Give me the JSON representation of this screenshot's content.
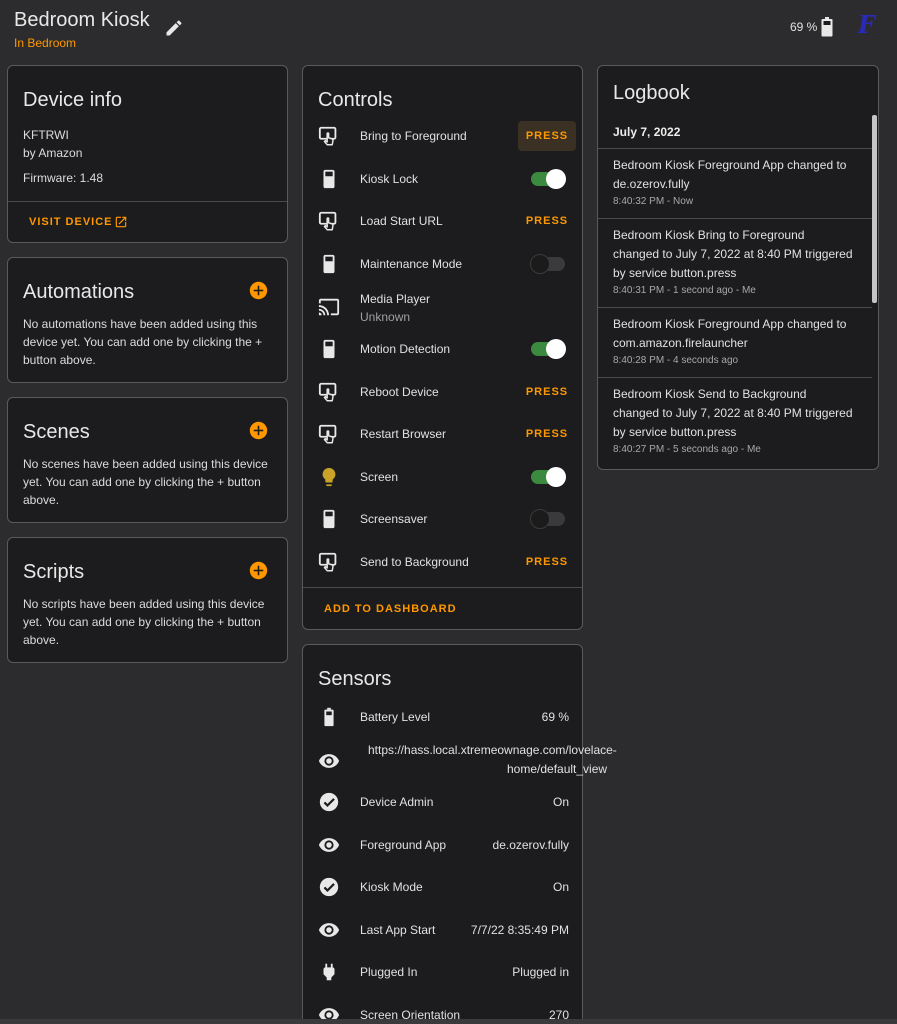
{
  "header": {
    "title": "Bedroom Kiosk",
    "subtitle": "In Bedroom",
    "battery": "69 %",
    "app_badge": "F"
  },
  "device_info": {
    "title": "Device info",
    "model": "KFTRWI",
    "manufacturer": "by Amazon",
    "firmware": "Firmware: 1.48",
    "visit_label": "VISIT DEVICE"
  },
  "automations": {
    "title": "Automations",
    "text": "No automations have been added using this device yet. You can add one by clicking the + button above."
  },
  "scenes": {
    "title": "Scenes",
    "text": "No scenes have been added using this device yet. You can add one by clicking the + button above."
  },
  "scripts": {
    "title": "Scripts",
    "text": "No scripts have been added using this device yet. You can add one by clicking the + button above."
  },
  "controls": {
    "title": "Controls",
    "press_label": "PRESS",
    "add_to_dashboard": "ADD TO DASHBOARD",
    "rows": [
      {
        "label": "Bring to Foreground",
        "icon": "gesture-tap-icon",
        "kind": "press"
      },
      {
        "label": "Kiosk Lock",
        "icon": "tablet-icon",
        "kind": "toggle",
        "on": true
      },
      {
        "label": "Load Start URL",
        "icon": "gesture-tap-icon",
        "kind": "press"
      },
      {
        "label": "Maintenance Mode",
        "icon": "tablet-icon",
        "kind": "toggle",
        "on": false
      },
      {
        "label": "Media Player",
        "sub": "Unknown",
        "icon": "cast-icon",
        "kind": "state"
      },
      {
        "label": "Motion Detection",
        "icon": "tablet-icon",
        "kind": "toggle",
        "on": true
      },
      {
        "label": "Reboot Device",
        "icon": "gesture-tap-icon",
        "kind": "press"
      },
      {
        "label": "Restart Browser",
        "icon": "gesture-tap-icon",
        "kind": "press"
      },
      {
        "label": "Screen",
        "icon": "lightbulb-icon",
        "kind": "toggle",
        "on": true
      },
      {
        "label": "Screensaver",
        "icon": "tablet-icon",
        "kind": "toggle",
        "on": false
      },
      {
        "label": "Send to Background",
        "icon": "gesture-tap-icon",
        "kind": "press"
      }
    ]
  },
  "sensors": {
    "title": "Sensors",
    "rows": [
      {
        "label": "Battery Level",
        "value": "69 %",
        "icon": "battery-icon"
      },
      {
        "label": "",
        "value": "https://hass.local.xtremeownage.com/lovelace-home/default_view",
        "value_line1": "https://hass.local.xtremeownage.com/lovelace-",
        "value_line2": "home/default_view",
        "icon": "eye-icon"
      },
      {
        "label": "Device Admin",
        "value": "On",
        "icon": "check-circle-icon"
      },
      {
        "label": "Foreground App",
        "value": "de.ozerov.fully",
        "icon": "eye-icon"
      },
      {
        "label": "Kiosk Mode",
        "value": "On",
        "icon": "check-circle-icon"
      },
      {
        "label": "Last App Start",
        "value": "7/7/22 8:35:49 PM",
        "icon": "eye-icon"
      },
      {
        "label": "Plugged In",
        "value": "Plugged in",
        "icon": "power-plug-icon"
      },
      {
        "label": "Screen Orientation",
        "value": "270",
        "icon": "eye-icon"
      }
    ]
  },
  "logbook": {
    "title": "Logbook",
    "date": "July 7, 2022",
    "entries": [
      {
        "line1": "Bedroom Kiosk Foreground App changed to",
        "line2": "de.ozerov.fully",
        "line3": "",
        "meta": "8:40:32 PM - Now"
      },
      {
        "line1": "Bedroom Kiosk Bring to Foreground",
        "line2": "changed to July 7, 2022 at 8:40 PM triggered",
        "line3": "by service button.press",
        "meta": "8:40:31 PM - 1 second ago - Me"
      },
      {
        "line1": "Bedroom Kiosk Foreground App changed to",
        "line2": "com.amazon.firelauncher",
        "line3": "",
        "meta": "8:40:28 PM - 4 seconds ago"
      },
      {
        "line1": "Bedroom Kiosk Send to Background",
        "line2": "changed to July 7, 2022 at 8:40 PM triggered",
        "line3": "by service button.press",
        "meta": "8:40:27 PM - 5 seconds ago - Me"
      }
    ]
  },
  "colors": {
    "accent": "#ff9800",
    "toggle_on": "#3c8a3f",
    "card_bg": "#1c1c1e",
    "page_bg": "#2c2c2e"
  }
}
